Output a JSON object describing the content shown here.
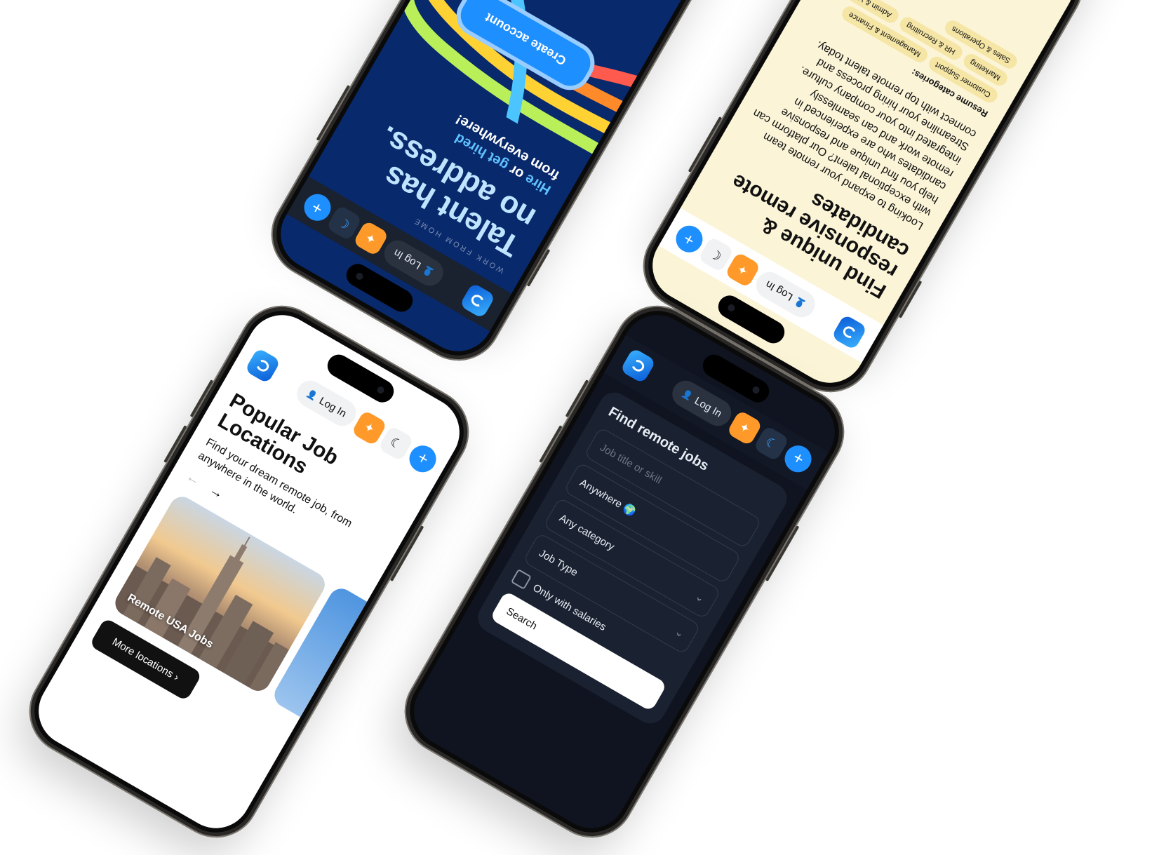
{
  "header": {
    "login_label": "Log In",
    "dark_login_label": "Log In",
    "star_glyph": "✦",
    "moon_glyph": "☾",
    "plus_glyph": "+",
    "user_glyph": "👤"
  },
  "blue_phone": {
    "eyebrow": "WORK FROM HOME",
    "headline_1": "Talent has",
    "headline_2": "no address.",
    "sub_hire": "Hire",
    "sub_or": "or",
    "sub_get_hired": "get hired",
    "sub_rest": "from everywhere!",
    "cta": "Create account"
  },
  "cream_phone": {
    "headline": "Find unique & responsive remote candidates",
    "body": "Looking to expand your remote team with exceptional talent? Our platform can help you find unique and responsive candidates who are experienced in remote work and can seamlessly integrated into your company culture. Streamline your hiring process and connect with top remote talent today.",
    "categories_label": "Resume categories:",
    "categories": [
      "Customer Support",
      "Management & Finance",
      "Marketing",
      "HR & Recruiting",
      "Admin & VA",
      "Sales & Operations"
    ]
  },
  "locations_phone": {
    "title": "Popular Job Locations",
    "subtitle": "Find your dream remote job, from anywhere in the world.",
    "arrow_prev": "←",
    "arrow_next": "→",
    "card_label": "Remote USA Jobs",
    "more_button": "More locations ›"
  },
  "search_phone": {
    "title": "Find remote jobs",
    "job_placeholder": "Job title or skill",
    "location_value": "Anywhere 🌍",
    "category_value": "Any category",
    "type_value": "Job Type",
    "salary_checkbox": "Only with salaries",
    "search_button": "Search",
    "chevron": "⌄"
  },
  "colors": {
    "brand_blue": "#1e8fff",
    "star_orange": "#ff9a2a",
    "navy": "#0b2a6b",
    "cream": "#fbf4d7",
    "dark": "#0f1420"
  }
}
